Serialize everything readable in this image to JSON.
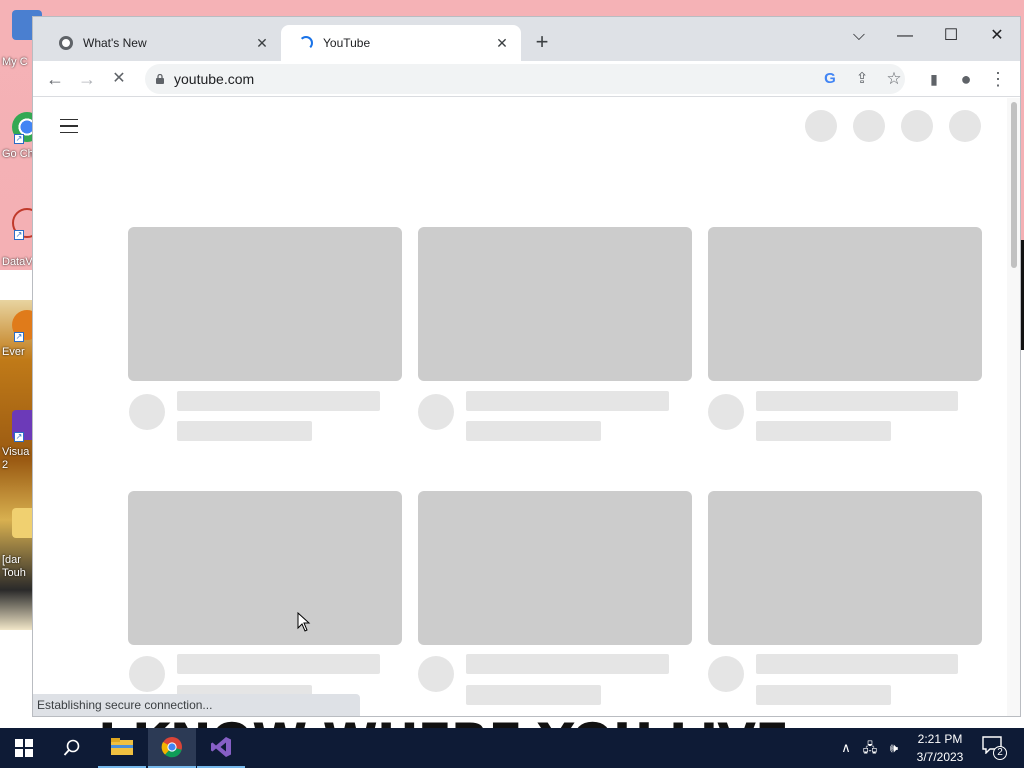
{
  "desktop": {
    "icons": [
      {
        "label": "My C"
      },
      {
        "label": "Go Ch"
      },
      {
        "label": "DataV"
      },
      {
        "label": "Ever"
      },
      {
        "label": "Visua 2"
      },
      {
        "label": "[dar Touh"
      }
    ],
    "wallpaper_text": "I KNOW WHERE YOU LIVE"
  },
  "browser": {
    "tabs": [
      {
        "title": "What's New",
        "icon": "chrome-icon",
        "state": "inactive"
      },
      {
        "title": "YouTube",
        "icon": "loading-spinner-icon",
        "state": "active"
      }
    ],
    "new_tab_symbol": "+",
    "window_controls": {
      "tab_search": "⌵",
      "minimize": "—",
      "maximize": "☐",
      "close": "✕"
    },
    "toolbar": {
      "back": "←",
      "forward": "→",
      "stop": "✕",
      "url": "youtube.com",
      "google_g": "G",
      "share": "⇪",
      "bookmark": "☆",
      "side_panel": "▮",
      "profile": "●",
      "menu": "⋮"
    },
    "status_text": "Establishing secure connection..."
  },
  "page": {
    "site": "YouTube",
    "state": "loading-skeleton"
  },
  "taskbar": {
    "apps": [
      "start-icon",
      "search-icon",
      "file-explorer-icon",
      "chrome-icon",
      "visual-studio-icon"
    ],
    "tray": {
      "chevron": "∧",
      "network": "🖧",
      "volume": "🕪"
    },
    "time": "2:21 PM",
    "date": "3/7/2023",
    "notification_count": "2"
  }
}
